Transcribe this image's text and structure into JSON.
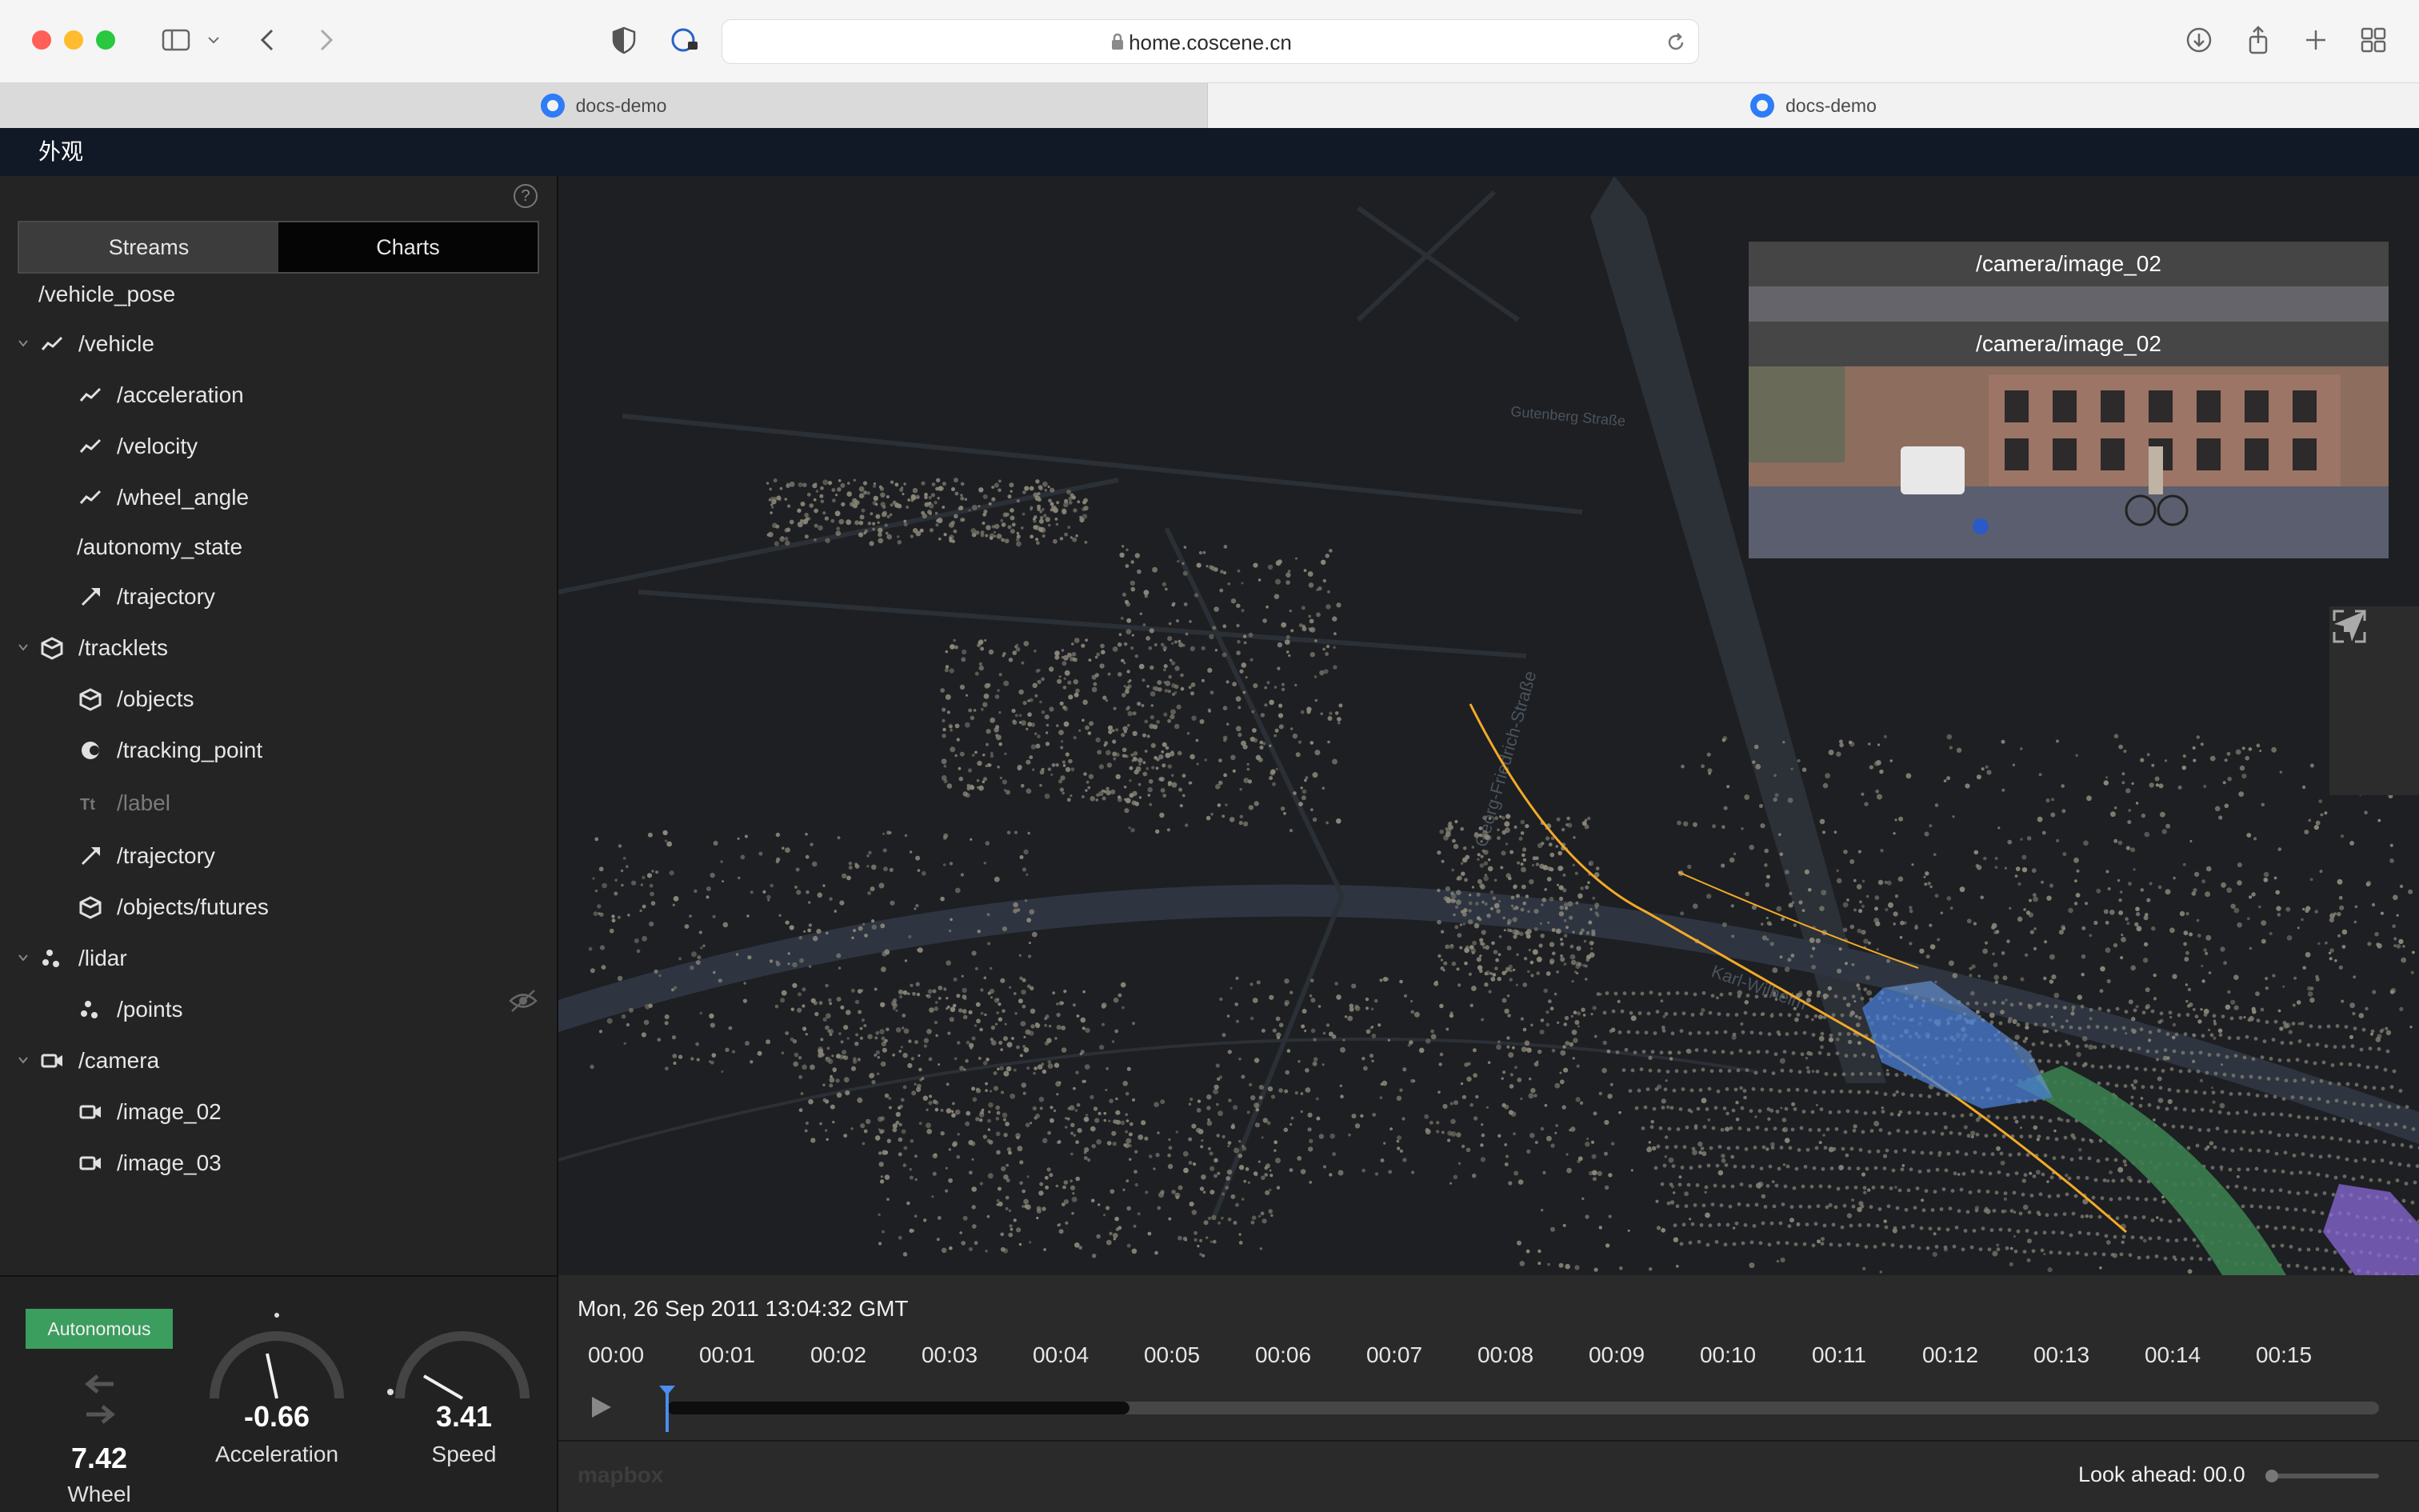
{
  "browser": {
    "url": "home.coscene.cn",
    "tabs": [
      {
        "label": "docs-demo",
        "active": false
      },
      {
        "label": "docs-demo",
        "active": true
      }
    ]
  },
  "app": {
    "header_title": "外观"
  },
  "sidebar": {
    "segments": [
      "Streams",
      "Charts"
    ],
    "active_segment": "Streams",
    "streams": [
      {
        "label": "/vehicle_pose",
        "icon": "none",
        "level": 0,
        "expanded": null
      },
      {
        "label": "/vehicle",
        "icon": "line-chart-icon",
        "level": 0,
        "expanded": true
      },
      {
        "label": "/acceleration",
        "icon": "line-chart-icon",
        "level": 1
      },
      {
        "label": "/velocity",
        "icon": "line-chart-icon",
        "level": 1
      },
      {
        "label": "/wheel_angle",
        "icon": "line-chart-icon",
        "level": 1
      },
      {
        "label": "/autonomy_state",
        "icon": "none",
        "level": 1
      },
      {
        "label": "/trajectory",
        "icon": "path-icon",
        "level": 1
      },
      {
        "label": "/tracklets",
        "icon": "cube-icon",
        "level": 0,
        "expanded": true
      },
      {
        "label": "/objects",
        "icon": "cube-icon",
        "level": 1
      },
      {
        "label": "/tracking_point",
        "icon": "circle-icon",
        "level": 1
      },
      {
        "label": "/label",
        "icon": "text-icon",
        "level": 1,
        "hidden": true
      },
      {
        "label": "/trajectory",
        "icon": "path-icon",
        "level": 1
      },
      {
        "label": "/objects/futures",
        "icon": "cube-icon",
        "level": 1
      },
      {
        "label": "/lidar",
        "icon": "points-icon",
        "level": 0,
        "expanded": true
      },
      {
        "label": "/points",
        "icon": "points-icon",
        "level": 1
      },
      {
        "label": "/camera",
        "icon": "video-icon",
        "level": 0,
        "expanded": true
      },
      {
        "label": "/image_02",
        "icon": "video-icon",
        "level": 1
      },
      {
        "label": "/image_03",
        "icon": "video-icon",
        "level": 1
      }
    ]
  },
  "metrics": {
    "autonomy_badge": "Autonomous",
    "wheel": {
      "value": "7.42",
      "label": "Wheel"
    },
    "acceleration": {
      "value": "-0.66",
      "label": "Acceleration"
    },
    "speed": {
      "value": "3.41",
      "label": "Speed"
    }
  },
  "viewport": {
    "camera_titles": [
      "/camera/image_02",
      "/camera/image_02"
    ],
    "street_labels": [
      "Georg-Friedrich-Straße",
      "Kaiser-Wilhelm-Straße",
      "Gutenberg Straße",
      "Karl-Wilhelm"
    ],
    "colors": {
      "trajectory": "#f3a928",
      "vehicle_box": "#4a7fd6",
      "path": "#3b7d4f",
      "future_object": "#8a6ad8"
    }
  },
  "timeline": {
    "datetime": "Mon, 26 Sep 2011 13:04:32 GMT",
    "ticks": [
      "00:00",
      "00:01",
      "00:02",
      "00:03",
      "00:04",
      "00:05",
      "00:06",
      "00:07",
      "00:08",
      "00:09",
      "00:10",
      "00:11",
      "00:12",
      "00:13",
      "00:14",
      "00:15"
    ],
    "playhead_progress": 0.0,
    "buffered_progress": 0.27,
    "look_ahead": "Look ahead: 00.0",
    "attribution": "mapbox"
  }
}
